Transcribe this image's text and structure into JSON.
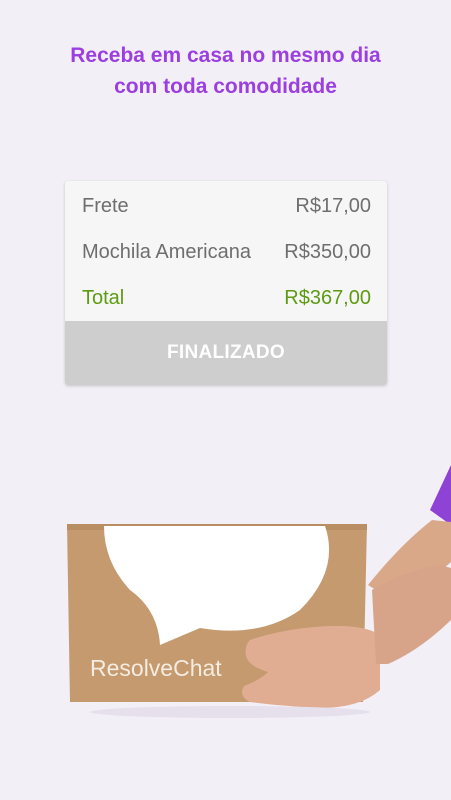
{
  "headline": {
    "line1": "Receba em casa no mesmo dia",
    "line2": "com toda comodidade"
  },
  "order": {
    "items": [
      {
        "label": "Frete",
        "value": "R$17,00"
      },
      {
        "label": "Mochila Americana",
        "value": "R$350,00"
      }
    ],
    "total": {
      "label": "Total",
      "value": "R$367,00"
    },
    "button_label": "FINALIZADO"
  },
  "box": {
    "brand": "ResolveChat"
  },
  "colors": {
    "accent": "#9b3fe0",
    "total": "#5d9b12",
    "background": "#f3eff7"
  }
}
